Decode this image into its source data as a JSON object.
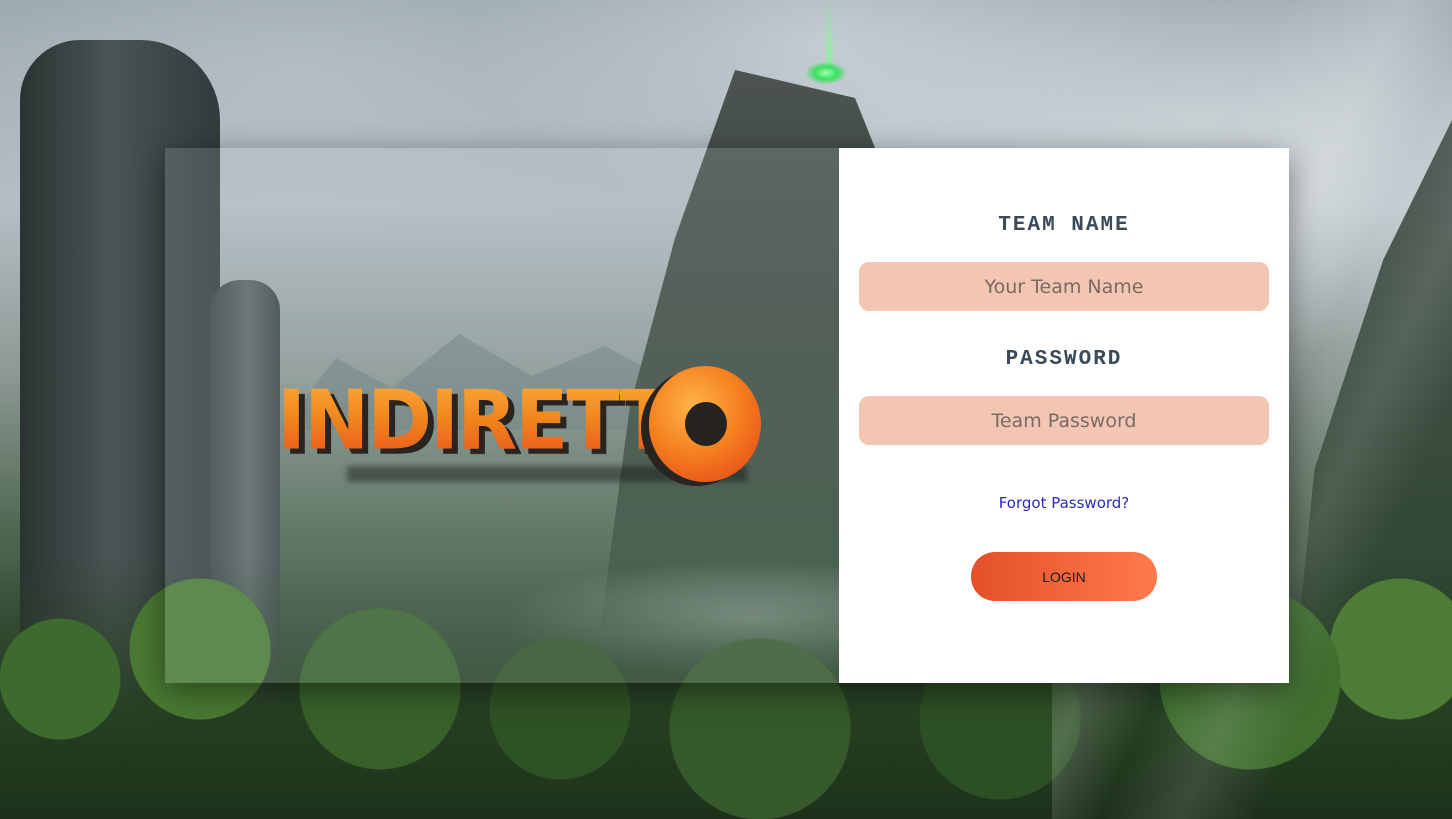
{
  "brand": {
    "logo_text": "INDIRETTO",
    "logo_letters_main": "INDIRETT",
    "logo_letter_o": "O"
  },
  "form": {
    "team_name_label": "TEAM NAME",
    "team_name_placeholder": "Your Team Name",
    "team_name_value": "",
    "password_label": "PASSWORD",
    "password_placeholder": "Team Password",
    "password_value": "",
    "forgot_password_link": "Forgot Password?",
    "login_button": "LOGIN"
  },
  "colors": {
    "input_background": "#f2c6b3",
    "button_gradient_start": "#e3502a",
    "button_gradient_end": "#ff7a4d",
    "label_color": "#3b4a59",
    "link_color": "#2a2ab8",
    "logo_orange": "#f08a1f"
  }
}
